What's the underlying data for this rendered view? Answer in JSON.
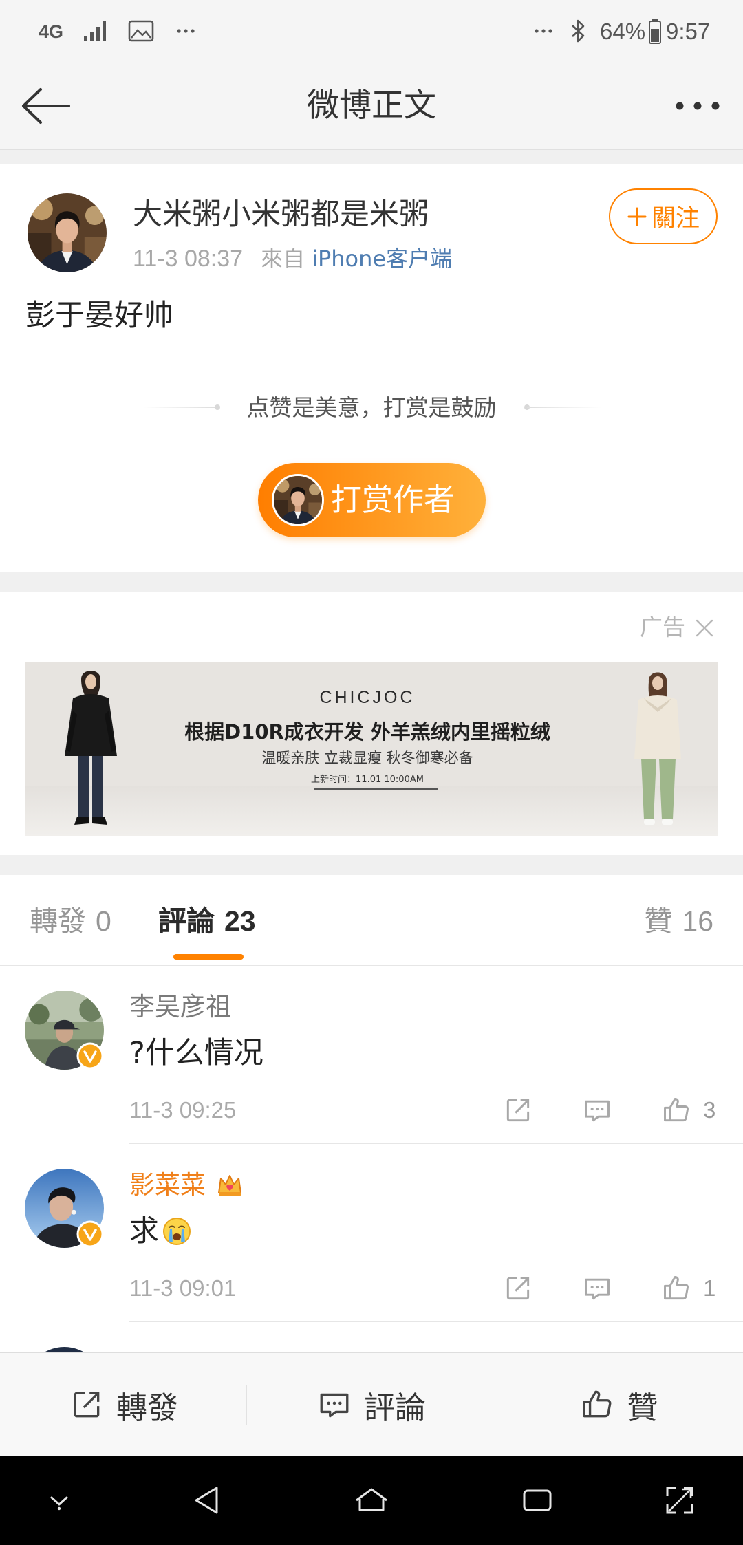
{
  "status_bar": {
    "network": "4G",
    "battery": "64%",
    "time": "9:57"
  },
  "header": {
    "title": "微博正文",
    "back_icon": "back-arrow-icon",
    "more_icon": "more-dots-icon"
  },
  "post": {
    "author": "大米粥小米粥都是米粥",
    "time": "11-3 08:37",
    "source_prefix": "來自",
    "source": "iPhone客户端",
    "follow_label": "關注",
    "text": "彭于晏好帅",
    "reward_tagline": "点赞是美意，打赏是鼓励",
    "reward_button": "打赏作者"
  },
  "ad": {
    "label": "广告",
    "brand": "CHICJOC",
    "headline": "根据D10R成衣开发 外羊羔绒内里摇粒绒",
    "subline": "温暖亲肤 立裁显瘦 秋冬御寒必备",
    "release": "上新时间：11.01  10:00AM"
  },
  "tabs": [
    {
      "label": "轉發",
      "count": "0",
      "active": false
    },
    {
      "label": "評論",
      "count": "23",
      "active": true
    },
    {
      "label": "贊",
      "count": "16",
      "active": false
    }
  ],
  "comments": [
    {
      "name": "李吴彦祖",
      "name_color": "#7a7a7a",
      "verified": true,
      "text": "?什么情况",
      "time": "11-3 09:25",
      "likes": "3"
    },
    {
      "name": "影菜菜",
      "name_color": "#f0801a",
      "verified": true,
      "badge_icon": "crown-badge-icon",
      "text": "求",
      "emoji_icon": "crying-face-icon",
      "time": "11-3 09:01",
      "likes": "1"
    }
  ],
  "bottom_bar": {
    "repost": "轉發",
    "comment": "評論",
    "like": "贊"
  },
  "colors": {
    "accent": "#ff8200",
    "link": "#4f7db1",
    "verified_badge": "#f7a518"
  }
}
